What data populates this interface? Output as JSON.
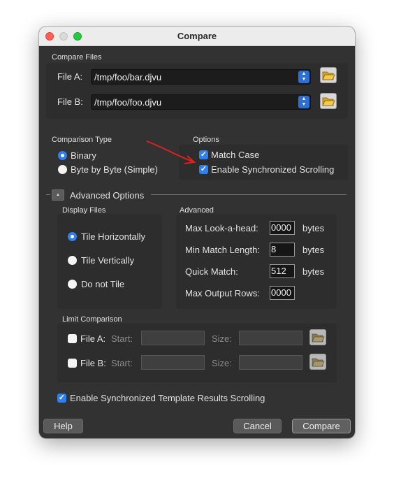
{
  "window": {
    "title": "Compare"
  },
  "compare_files": {
    "section_label": "Compare Files",
    "file_a": {
      "label": "File A:",
      "value": "/tmp/foo/bar.djvu"
    },
    "file_b": {
      "label": "File B:",
      "value": "/tmp/foo/foo.djvu"
    }
  },
  "comparison_type": {
    "section_label": "Comparison Type",
    "options": [
      {
        "label": "Binary",
        "selected": true
      },
      {
        "label": "Byte by Byte (Simple)",
        "selected": false
      }
    ]
  },
  "options": {
    "section_label": "Options",
    "match_case": {
      "label": "Match Case",
      "checked": true
    },
    "sync_scrolling": {
      "label": "Enable Synchronized Scrolling",
      "checked": true
    }
  },
  "advanced_options": {
    "label": "Advanced Options",
    "expander_glyph": "▲",
    "display_files": {
      "section_label": "Display Files",
      "options": [
        {
          "label": "Tile Horizontally",
          "selected": true
        },
        {
          "label": "Tile Vertically",
          "selected": false
        },
        {
          "label": "Do not Tile",
          "selected": false
        }
      ]
    },
    "advanced": {
      "section_label": "Advanced",
      "rows": [
        {
          "label": "Max Look-a-head:",
          "value": "0000",
          "unit": "bytes"
        },
        {
          "label": "Min Match Length:",
          "value": "8",
          "unit": "bytes"
        },
        {
          "label": "Quick Match:",
          "value": "512",
          "unit": "bytes"
        },
        {
          "label": "Max Output Rows:",
          "value": "0000",
          "unit": ""
        }
      ]
    },
    "limit_comparison": {
      "section_label": "Limit Comparison",
      "rows": [
        {
          "label": "File A:",
          "start_label": "Start:",
          "size_label": "Size:",
          "checked": false
        },
        {
          "label": "File B:",
          "start_label": "Start:",
          "size_label": "Size:",
          "checked": false
        }
      ]
    }
  },
  "template_sync": {
    "label": "Enable Synchronized Template Results Scrolling",
    "checked": true
  },
  "buttons": {
    "help": "Help",
    "cancel": "Cancel",
    "compare": "Compare"
  },
  "colors": {
    "accent": "#2f7ff0",
    "window_bg": "#333232",
    "annotation_arrow": "#e02020"
  },
  "icons": {
    "browse": "folder-open-icon",
    "browse_disabled": "folder-open-icon"
  }
}
